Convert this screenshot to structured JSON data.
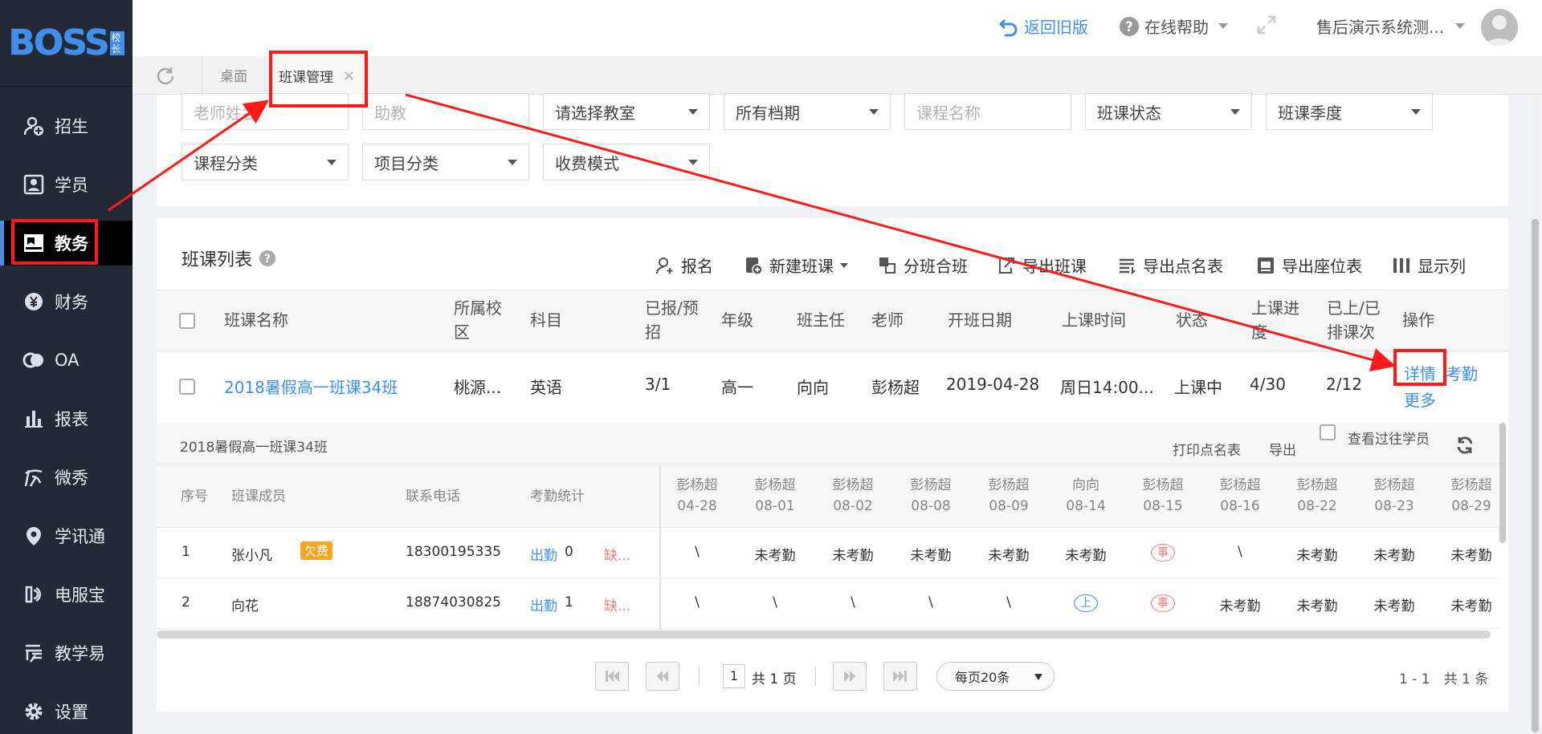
{
  "logo": {
    "text": "BOSS",
    "tag": "校长"
  },
  "sidebar": {
    "items": [
      {
        "label": "招生",
        "icon": "user-add-icon"
      },
      {
        "label": "学员",
        "icon": "student-card-icon"
      },
      {
        "label": "教务",
        "icon": "book-icon",
        "active": true
      },
      {
        "label": "财务",
        "icon": "yen-icon"
      },
      {
        "label": "OA",
        "icon": "oa-icon"
      },
      {
        "label": "报表",
        "icon": "bar-chart-icon"
      },
      {
        "label": "微秀",
        "icon": "weixiu-icon"
      },
      {
        "label": "学讯通",
        "icon": "location-pin-icon"
      },
      {
        "label": "电服宝",
        "icon": "phone-service-icon"
      },
      {
        "label": "教学易",
        "icon": "teaching-icon"
      },
      {
        "label": "设置",
        "icon": "gear-icon"
      }
    ]
  },
  "header": {
    "back_old": "返回旧版",
    "help": "在线帮助",
    "user": "售后演示系统测..."
  },
  "tabs": [
    {
      "label": "桌面"
    },
    {
      "label": "班课管理",
      "active": true,
      "close": "×"
    }
  ],
  "filters": {
    "teacher_placeholder": "老师姓名",
    "assistant_placeholder": "助教",
    "classroom": "请选择教室",
    "schedule": "所有档期",
    "course_placeholder": "课程名称",
    "class_status": "班课状态",
    "class_season": "班课季度",
    "course_category": "课程分类",
    "project_category": "项目分类",
    "fee_mode": "收费模式"
  },
  "list": {
    "title": "班课列表",
    "toolbar": {
      "enroll": "报名",
      "new_class": "新建班课",
      "split_merge": "分班合班",
      "export_class": "导出班课",
      "export_roll": "导出点名表",
      "export_seat": "导出座位表",
      "show_cols": "显示列"
    },
    "headers": {
      "name": "班课名称",
      "campus_1": "所属校",
      "campus_2": "区",
      "subject": "科目",
      "enrolled_1": "已报/预",
      "enrolled_2": "招",
      "grade": "年级",
      "head_teacher": "班主任",
      "teacher": "老师",
      "start_date": "开班日期",
      "class_time": "上课时间",
      "status": "状态",
      "progress_1": "上课进",
      "progress_2": "度",
      "sessions_1": "已上/已",
      "sessions_2": "排课次",
      "ops": "操作"
    },
    "row": {
      "name": "2018暑假高一班课34班",
      "campus": "桃源...",
      "subject": "英语",
      "enrolled": "3/1",
      "grade": "高一",
      "head_teacher": "向向",
      "teacher": "彭杨超",
      "start_date": "2019-04-28",
      "class_time": "周日14:00...",
      "status": "上课中",
      "progress": "4/30",
      "sessions": "2/12",
      "op_detail": "详情",
      "op_attendance": "考勤",
      "op_more": "更多"
    }
  },
  "detail": {
    "title": "2018暑假高一班课34班",
    "print_roll": "打印点名表",
    "export": "导出",
    "view_past": "查看过往学员",
    "headers": {
      "no": "序号",
      "member": "班课成员",
      "phone": "联系电话",
      "stats": "考勤统计"
    },
    "sessions": [
      {
        "teacher": "彭杨超",
        "date": "04-28"
      },
      {
        "teacher": "彭杨超",
        "date": "08-01"
      },
      {
        "teacher": "彭杨超",
        "date": "08-02"
      },
      {
        "teacher": "彭杨超",
        "date": "08-08"
      },
      {
        "teacher": "彭杨超",
        "date": "08-09"
      },
      {
        "teacher": "向向",
        "date": "08-14"
      },
      {
        "teacher": "彭杨超",
        "date": "08-15"
      },
      {
        "teacher": "彭杨超",
        "date": "08-16"
      },
      {
        "teacher": "彭杨超",
        "date": "08-22"
      },
      {
        "teacher": "彭杨超",
        "date": "08-23"
      },
      {
        "teacher": "彭杨超",
        "date": "08-29"
      }
    ],
    "rows": [
      {
        "no": "1",
        "name": "张小凡",
        "badge": "欠费",
        "phone": "18300195335",
        "present_label": "出勤",
        "present": "0",
        "absent": "缺...",
        "marks": [
          "\\",
          "未考勤",
          "未考勤",
          "未考勤",
          "未考勤",
          "未考勤",
          "事",
          "\\",
          "未考勤",
          "未考勤",
          "未考勤"
        ]
      },
      {
        "no": "2",
        "name": "向花",
        "badge": "",
        "phone": "18874030825",
        "present_label": "出勤",
        "present": "1",
        "absent": "缺...",
        "marks": [
          "\\",
          "\\",
          "\\",
          "\\",
          "\\",
          "上",
          "事",
          "未考勤",
          "未考勤",
          "未考勤",
          "未考勤"
        ]
      }
    ]
  },
  "pagination": {
    "page": "1",
    "total_pages": "共 1 页",
    "page_size": "每页20条",
    "summary": "1 - 1　共 1 条"
  },
  "colors": {
    "sidebar": "#232a35",
    "accent": "#3f8ff2",
    "annotation": "#ff1a1a",
    "badge": "#f5a623"
  }
}
